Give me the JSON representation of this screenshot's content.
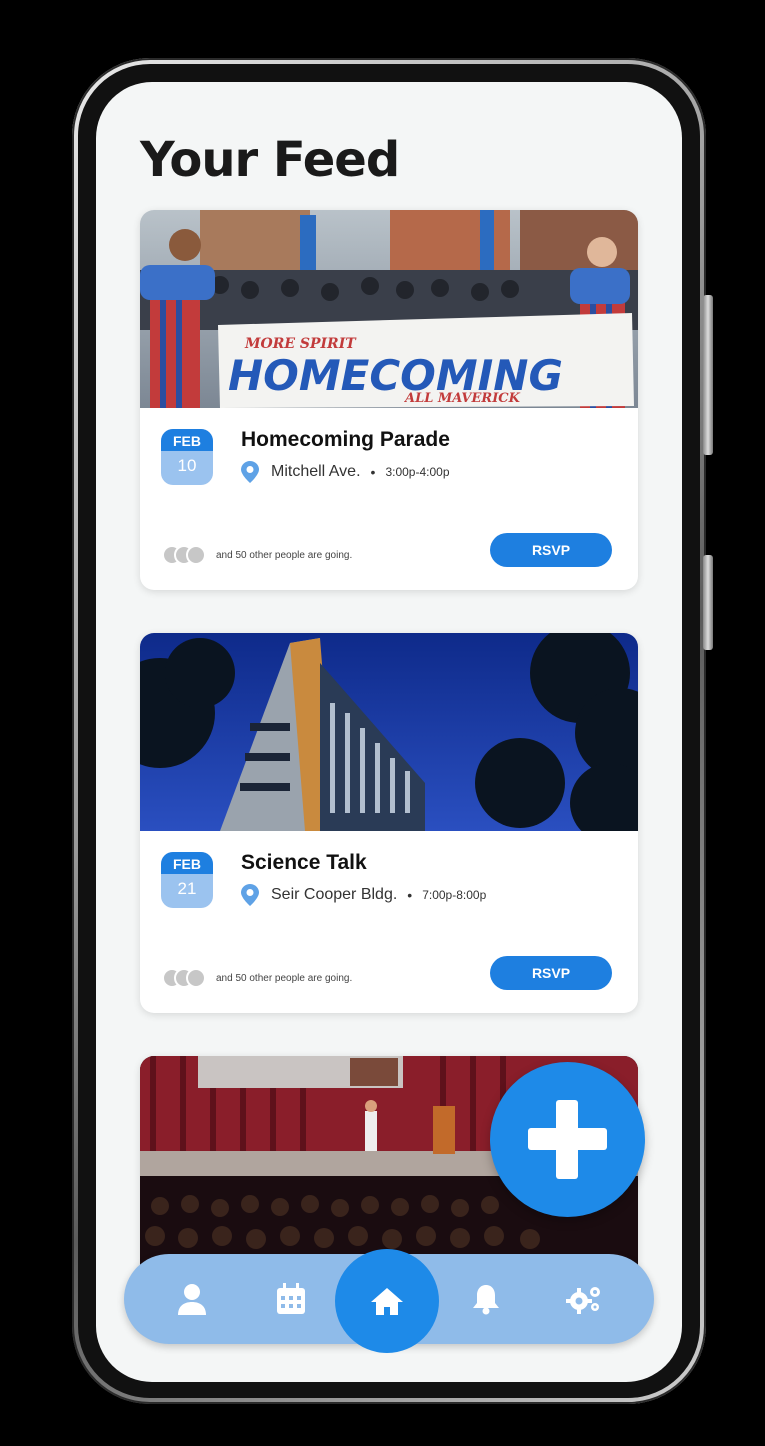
{
  "screen": {
    "title": "Your Feed"
  },
  "events": [
    {
      "title": "Homecoming Parade",
      "month": "FEB",
      "day": "10",
      "location": "Mitchell Ave.",
      "time": "3:00p-4:00p",
      "attendance": "and 50 other people are going.",
      "rsvp_label": "RSVP",
      "banner_text": {
        "line1": "MORE SPIRIT",
        "line2": "HOMECOMING",
        "line3": "ALL MAVERICK"
      }
    },
    {
      "title": "Science Talk",
      "month": "FEB",
      "day": "21",
      "location": "Seir Cooper Bldg.",
      "time": "7:00p-8:00p",
      "attendance": "and 50 other people are going.",
      "rsvp_label": "RSVP"
    }
  ],
  "nav": {
    "items": [
      {
        "icon": "user-icon"
      },
      {
        "icon": "calendar-icon"
      },
      {
        "icon": "home-icon",
        "active": true
      },
      {
        "icon": "bell-icon"
      },
      {
        "icon": "gears-icon"
      }
    ]
  },
  "fab": {
    "icon": "plus-icon"
  },
  "colors": {
    "accent": "#1e7fe0",
    "nav_bg": "#8fbbe9",
    "badge_light": "#9bc3ef",
    "screen_bg": "#f4f6f6"
  }
}
